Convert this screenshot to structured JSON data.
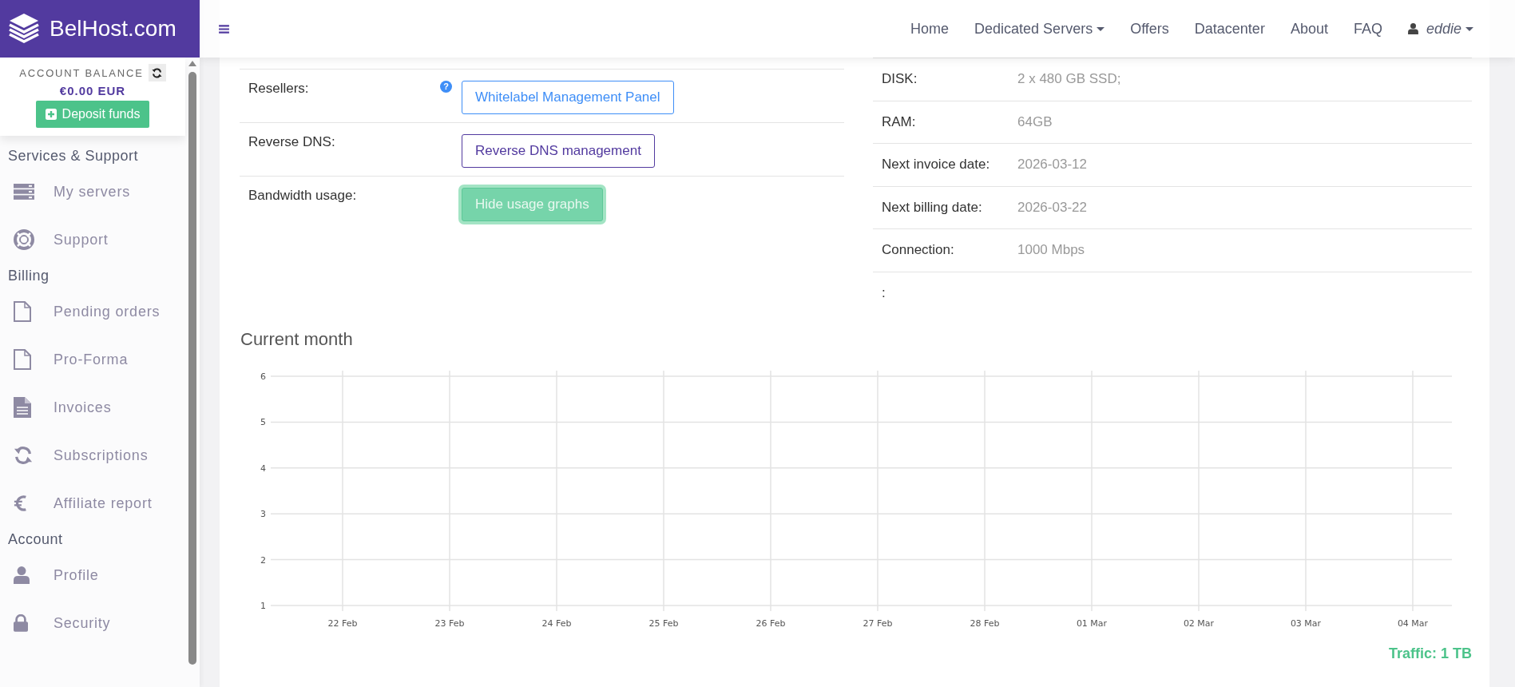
{
  "brand": {
    "name": "BelHost.com"
  },
  "account": {
    "label": "ACCOUNT BALANCE",
    "balance": "€0.00 EUR",
    "deposit": "Deposit funds"
  },
  "sidebar": {
    "sections": [
      {
        "title": "Services & Support",
        "items": [
          {
            "label": "My servers",
            "kind": "servers"
          },
          {
            "label": "Support",
            "kind": "lifebuoy"
          }
        ]
      },
      {
        "title": "Billing",
        "items": [
          {
            "label": "Pending orders",
            "kind": "file"
          },
          {
            "label": "Pro-Forma",
            "kind": "file"
          },
          {
            "label": "Invoices",
            "kind": "filetext"
          },
          {
            "label": "Subscriptions",
            "kind": "sync"
          },
          {
            "label": "Affiliate report",
            "kind": "euro"
          }
        ]
      },
      {
        "title": "Account",
        "items": [
          {
            "label": "Profile",
            "kind": "user"
          },
          {
            "label": "Security",
            "kind": "lock"
          }
        ]
      }
    ]
  },
  "nav": {
    "items": [
      {
        "label": "Home",
        "dropdown": false
      },
      {
        "label": "Dedicated Servers",
        "dropdown": true
      },
      {
        "label": "Offers",
        "dropdown": false
      },
      {
        "label": "Datacenter",
        "dropdown": false
      },
      {
        "label": "About",
        "dropdown": false
      },
      {
        "label": "FAQ",
        "dropdown": false
      }
    ],
    "user": "eddie"
  },
  "server": {
    "options": [
      {
        "label": "Resellers:",
        "kind": "button",
        "help": "?",
        "button": "Whitelabel Management Panel",
        "focused": false
      },
      {
        "label": "Reverse DNS:",
        "kind": "button",
        "button": "Reverse DNS management",
        "focused": false
      },
      {
        "label": "Bandwidth usage:",
        "kind": "button",
        "button": "Hide usage graphs",
        "focused": true
      }
    ],
    "specs": [
      {
        "label": "DISK:",
        "value": "2 x 480 GB SSD;"
      },
      {
        "label": "RAM:",
        "value": "64GB"
      },
      {
        "label": "Next invoice date:",
        "value": "2026-03-12"
      },
      {
        "label": "Next billing date:",
        "value": "2026-03-22"
      },
      {
        "label": "Connection:",
        "value": "1000 Mbps"
      },
      {
        "label": ":"
      }
    ]
  },
  "usage": {
    "title": "Current month",
    "chart_data": {
      "type": "line",
      "categories": [
        "22 Feb",
        "23 Feb",
        "24 Feb",
        "25 Feb",
        "26 Feb",
        "27 Feb",
        "28 Feb",
        "01 Mar",
        "02 Mar",
        "03 Mar",
        "04 Mar"
      ],
      "ylim": [
        1,
        6
      ],
      "yticks": [
        1,
        2,
        3,
        4,
        5,
        6
      ],
      "grid": true
    },
    "traffic": "Traffic: 1 TB"
  }
}
